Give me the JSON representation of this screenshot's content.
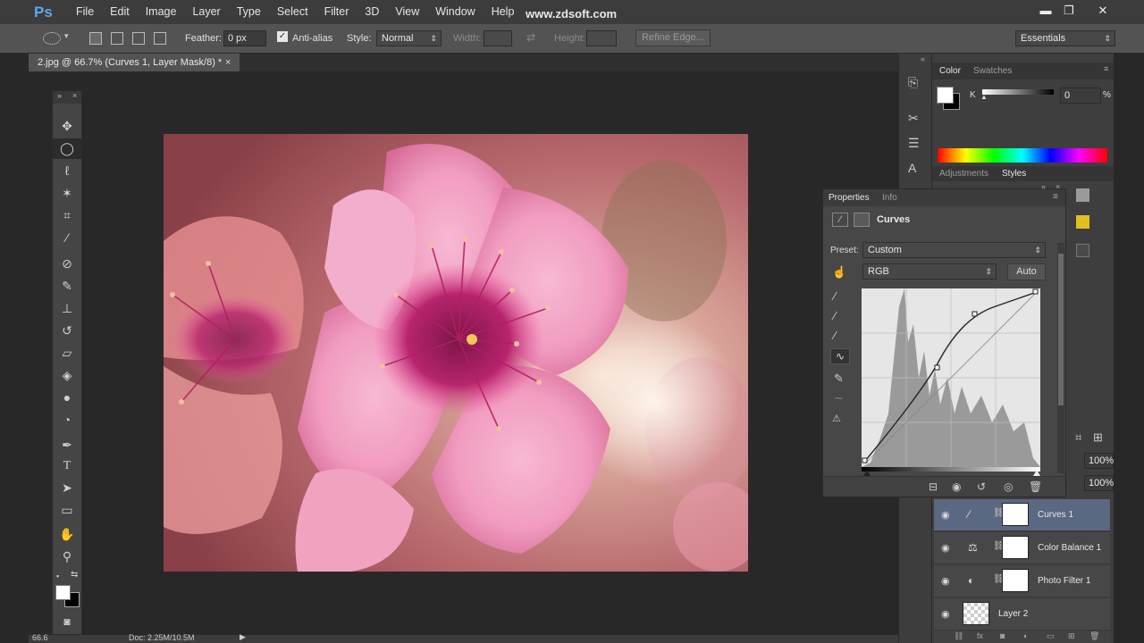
{
  "app": {
    "logo": "Ps",
    "watermark": "www.zdsoft.com"
  },
  "menu": [
    "File",
    "Edit",
    "Image",
    "Layer",
    "Type",
    "Select",
    "Filter",
    "3D",
    "View",
    "Window",
    "Help"
  ],
  "window_controls": {
    "minimize": "▬",
    "restore": "❐",
    "close": "✕"
  },
  "options": {
    "feather_label": "Feather:",
    "feather_value": "0 px",
    "antialias_label": "Anti-alias",
    "style_label": "Style:",
    "style_value": "Normal",
    "width_label": "Width:",
    "height_label": "Height:",
    "refine_edge": "Refine Edge...",
    "workspace": "Essentials"
  },
  "document": {
    "tab_title": "2.jpg @ 66.7% (Curves 1, Layer Mask/8) *",
    "close": "×"
  },
  "status": {
    "zoom": "66.6",
    "doc_info": "Doc: 2.25M/10.5M"
  },
  "color_panel": {
    "tabs": [
      "Color",
      "Swatches"
    ],
    "channel_label": "K",
    "channel_value": "0",
    "unit": "%"
  },
  "adjustments_panel": {
    "tabs": [
      "Adjustments",
      "Styles"
    ]
  },
  "properties": {
    "tabs": [
      "Properties",
      "Info"
    ],
    "title": "Curves",
    "preset_label": "Preset:",
    "preset_value": "Custom",
    "channel_value": "RGB",
    "auto_label": "Auto"
  },
  "layers_controls": {
    "opacity": "100%",
    "fill": "100%"
  },
  "layers": [
    {
      "name": "Curves 1",
      "selected": true
    },
    {
      "name": "Color Balance 1",
      "selected": false
    },
    {
      "name": "Photo Filter 1",
      "selected": false
    },
    {
      "name": "Layer 2",
      "selected": false
    }
  ],
  "colors": {
    "accent": "#5b6882",
    "panel": "#474747",
    "chrome": "#3c3c3c"
  }
}
